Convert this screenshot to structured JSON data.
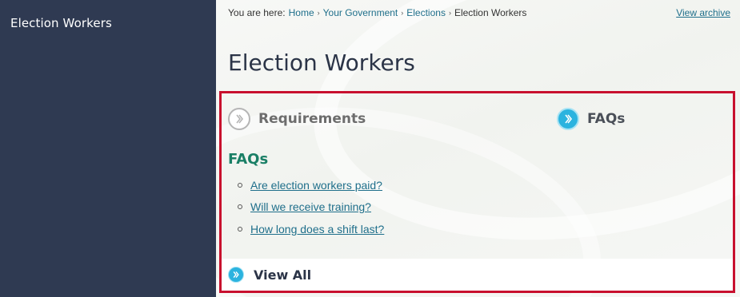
{
  "sidebar": {
    "title": "Election Workers"
  },
  "breadcrumb": {
    "prefix": "You are here:",
    "items": [
      {
        "label": "Home"
      },
      {
        "label": "Your Government"
      },
      {
        "label": "Elections"
      },
      {
        "label": "Election Workers"
      }
    ],
    "separator": "›"
  },
  "header": {
    "view_archive": "View archive",
    "page_title": "Election Workers"
  },
  "panel": {
    "tabs": [
      {
        "label": "Requirements",
        "icon": "chevron-right-circle-icon",
        "state": "inactive"
      },
      {
        "label": "FAQs",
        "icon": "chevron-right-circle-icon",
        "state": "active"
      }
    ],
    "faq_heading": "FAQs",
    "faq_items": [
      {
        "label": "Are election workers paid?"
      },
      {
        "label": "Will we receive training?"
      },
      {
        "label": "How long does a shift last?"
      }
    ],
    "view_all": "View All"
  },
  "colors": {
    "sidebar_bg": "#2f3a52",
    "link": "#1f6f8b",
    "faq_heading": "#1a7f66",
    "highlight_border": "#c8102e",
    "active_icon": "#2bb3df"
  }
}
